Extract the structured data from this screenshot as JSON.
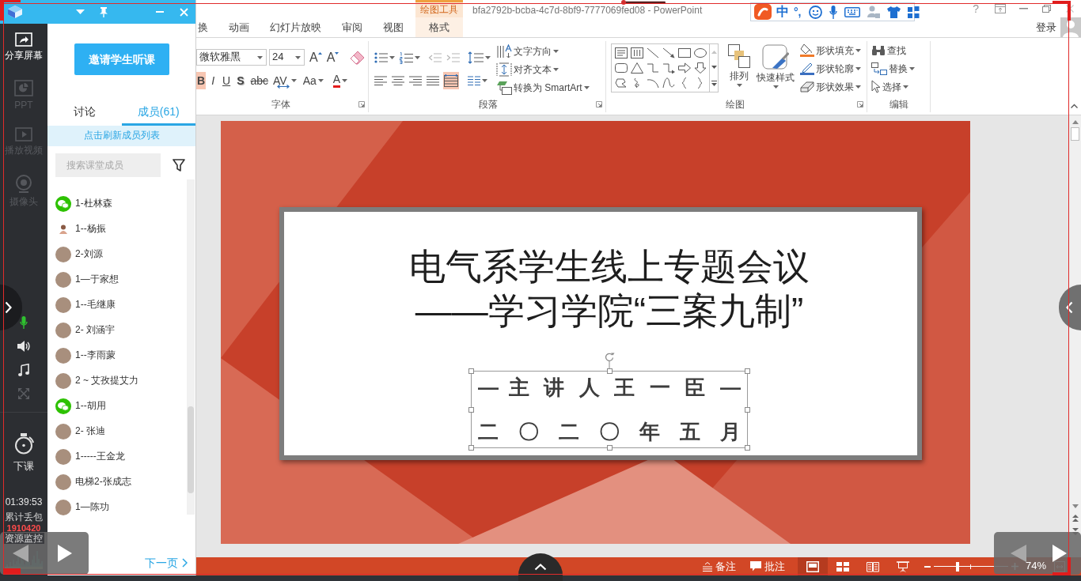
{
  "panel": {
    "sidebar": {
      "items": [
        {
          "kind": "share",
          "label": "分享屏幕",
          "disabled": false
        },
        {
          "kind": "ppt",
          "label": "PPT",
          "disabled": true
        },
        {
          "kind": "video",
          "label": "播放视频",
          "disabled": true
        },
        {
          "kind": "camera",
          "label": "摄像头",
          "disabled": true
        }
      ],
      "controls": [
        {
          "kind": "mic",
          "on": true,
          "disabled": false
        },
        {
          "kind": "speaker",
          "on": false,
          "disabled": false
        },
        {
          "kind": "music",
          "on": false,
          "disabled": false
        },
        {
          "kind": "fullscreen",
          "on": false,
          "disabled": true
        }
      ],
      "end_class": "下课",
      "timer": "01:39:53",
      "packet_loss_label": "累计丢包",
      "packet_loss_value": "1910420",
      "monitor_label": "资源监控"
    },
    "invite_button": "邀请学生听课",
    "tabs": [
      {
        "label": "讨论",
        "selected": false
      },
      {
        "label": "成员(61)",
        "selected": true
      }
    ],
    "refresh_bar": "点击刷新成员列表",
    "search": {
      "placeholder": "搜索课堂成员"
    },
    "members": [
      {
        "name": "1-杜林森",
        "kind": "wechat"
      },
      {
        "name": "1--杨振",
        "kind": "figure"
      },
      {
        "name": "2-刘源",
        "kind": "photo"
      },
      {
        "name": "1—于家想",
        "kind": "photo"
      },
      {
        "name": "1--毛继康",
        "kind": "photo"
      },
      {
        "name": "2- 刘涵宇",
        "kind": "photo"
      },
      {
        "name": "1--李雨蒙",
        "kind": "photo"
      },
      {
        "name": "2 ~ 艾孜提艾力",
        "kind": "photo"
      },
      {
        "name": "1--胡用",
        "kind": "wechat"
      },
      {
        "name": "2- 张迪",
        "kind": "photo"
      },
      {
        "name": "1-----王金龙",
        "kind": "photo"
      },
      {
        "name": "电梯2-张成志",
        "kind": "photo"
      },
      {
        "name": "1—陈功",
        "kind": "photo"
      }
    ],
    "next_page": "下一页"
  },
  "ime_toolbar": {
    "mode": "中",
    "punctuation": "°,"
  },
  "powerpoint": {
    "title": "bfa2792b-bcba-4c7d-8bf9-7777069fed08 - PowerPoint",
    "tool_group": "绘图工具",
    "help": "?",
    "tabs": [
      {
        "label": "换",
        "kind": "normal",
        "selected": false
      },
      {
        "label": "动画",
        "kind": "normal",
        "selected": false
      },
      {
        "label": "幻灯片放映",
        "kind": "normal",
        "selected": false
      },
      {
        "label": "审阅",
        "kind": "normal",
        "selected": false
      },
      {
        "label": "视图",
        "kind": "normal",
        "selected": false
      },
      {
        "label": "格式",
        "kind": "contextual",
        "selected": false
      }
    ],
    "sign_in": "登录",
    "ribbon": {
      "font": {
        "label": "字体",
        "font_name": "微软雅黑",
        "font_size": "24",
        "size_buttons": [
          {
            "kind": "grow",
            "label": "A"
          },
          {
            "kind": "shrink",
            "label": "A"
          }
        ],
        "format_buttons": [
          {
            "kind": "bold",
            "label": "B",
            "on": true
          },
          {
            "kind": "italic",
            "label": "I",
            "on": false
          },
          {
            "kind": "underline",
            "label": "U",
            "on": false
          },
          {
            "kind": "shadow",
            "label": "S",
            "on": false
          },
          {
            "kind": "strike",
            "label": "abc",
            "on": false
          },
          {
            "kind": "spacing",
            "label": "AV",
            "on": false
          },
          {
            "kind": "case",
            "label": "Aa",
            "on": false
          },
          {
            "kind": "color",
            "label": "A",
            "on": false
          }
        ]
      },
      "paragraph": {
        "label": "段落",
        "text_direction": "文字方向",
        "align_text": "对齐文本",
        "smartart": "转换为 SmartArt",
        "alignments": [
          {
            "kind": "left",
            "selected": false
          },
          {
            "kind": "center",
            "selected": false
          },
          {
            "kind": "right",
            "selected": false
          },
          {
            "kind": "justify",
            "selected": false
          },
          {
            "kind": "distributed",
            "selected": true
          }
        ]
      },
      "drawing": {
        "label": "绘图",
        "arrange": "排列",
        "quick_styles": "快速样式",
        "shape_fill": "形状填充",
        "shape_outline": "形状轮廓",
        "shape_effects": "形状效果"
      },
      "editing": {
        "label": "编辑",
        "find": "查找",
        "replace": "替换",
        "select": "选择"
      }
    },
    "slide": {
      "title_lines": [
        "电气系学生线上专题会议",
        "——学习学院“三案九制”"
      ],
      "subtitle_lines": [
        "— 主 讲 人 王 一 臣 —",
        "二 〇 二 〇 年 五 月"
      ],
      "subtitle_selected": true
    },
    "status_bar": {
      "notes": "备注",
      "comments": "批注",
      "views": [
        {
          "kind": "normal",
          "selected": true
        },
        {
          "kind": "sorter",
          "selected": false
        },
        {
          "kind": "reading",
          "selected": false
        },
        {
          "kind": "slideshow",
          "selected": false
        }
      ],
      "zoom_slider": {
        "level": 0.32
      },
      "zoom_text": "74%"
    }
  }
}
